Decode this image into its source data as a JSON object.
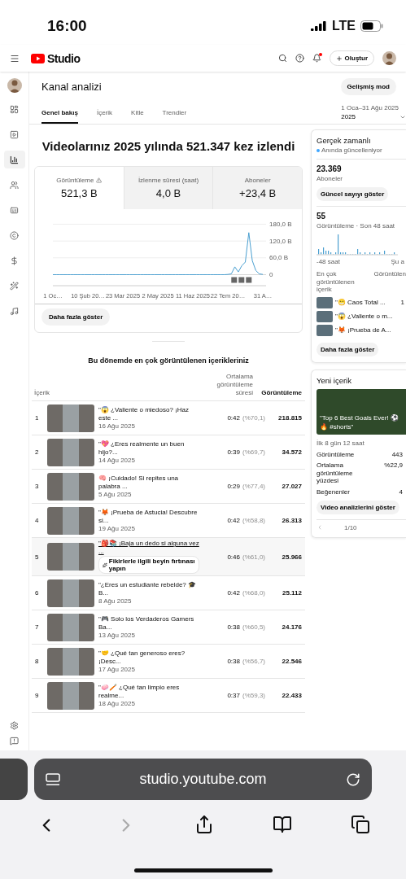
{
  "status_bar": {
    "time": "16:00",
    "network": "LTE"
  },
  "header": {
    "logo_text": "Studio",
    "create_label": "Oluştur",
    "notification_badge": true
  },
  "page": {
    "title": "Kanal analizi",
    "mode_button": "Gelişmiş mod"
  },
  "tabs": [
    {
      "label": "Genel bakış",
      "selected": true
    },
    {
      "label": "İçerik",
      "selected": false
    },
    {
      "label": "Kitle",
      "selected": false
    },
    {
      "label": "Trendler",
      "selected": false
    }
  ],
  "date_range": {
    "range": "1 Oca–31 Ağu 2025",
    "label": "2025"
  },
  "headline": "Videolarınız 2025 yılında 521.347 kez izlendi",
  "metrics": [
    {
      "label": "Görüntüleme",
      "value": "521,3 B",
      "selected": true,
      "warning": true
    },
    {
      "label": "İzlenme süresi (saat)",
      "value": "4,0 B",
      "selected": false,
      "warning": false
    },
    {
      "label": "Aboneler",
      "value": "+23,4 B",
      "selected": false,
      "warning": false
    }
  ],
  "chart_data": {
    "type": "line",
    "categories": [
      "1 Oc…",
      null,
      null,
      null,
      null,
      null,
      null,
      null,
      null,
      null,
      "10 Şub 20…",
      null,
      null,
      null,
      null,
      null,
      null,
      null,
      null,
      null,
      "23 Mar 2025",
      null,
      null,
      null,
      null,
      null,
      null,
      null,
      null,
      null,
      "2 May 2025",
      null,
      null,
      null,
      null,
      null,
      null,
      null,
      null,
      null,
      "11 Haz 2025",
      null,
      null,
      null,
      null,
      null,
      null,
      null,
      null,
      null,
      "22 Tem 20…",
      null,
      null,
      null,
      null,
      null,
      null,
      null,
      null,
      null,
      "31 A…"
    ],
    "series": [
      {
        "color": "#4a9fd0",
        "values": [
          0,
          0,
          0,
          0,
          0,
          0,
          0,
          0,
          0,
          0,
          0,
          0,
          0,
          0,
          0,
          0,
          0,
          0,
          0,
          0,
          0,
          0,
          0,
          0,
          0,
          0,
          0,
          0,
          0,
          0,
          0,
          0,
          0,
          0,
          0,
          0,
          0,
          0,
          0,
          0,
          0,
          0,
          0,
          0,
          0,
          0,
          0,
          0,
          0,
          0,
          1,
          3,
          28,
          10,
          32,
          45,
          150,
          50,
          15,
          3,
          1
        ]
      }
    ],
    "ylim": [
      0,
      180
    ],
    "yticks": [
      {
        "value": 0,
        "label": "0"
      },
      {
        "value": 60,
        "label": "60,0 B"
      },
      {
        "value": 120,
        "label": "120,0 B"
      },
      {
        "value": 180,
        "label": "180,0 B"
      }
    ]
  },
  "show_more": "Daha fazla göster",
  "top_content": {
    "title": "Bu dönemde en çok görüntülenen içerikleriniz",
    "columns": [
      "İçerik",
      "Ortalama görüntüleme süresi",
      "Görüntüleme"
    ],
    "rows": [
      {
        "rank": "1",
        "title": "\"😱 ¿Valiente o miedoso? ¡Haz este ...",
        "date": "16 Ağu 2025",
        "duration": "0:42",
        "percent": "(%70,1)",
        "views": "218.815",
        "hovered": false
      },
      {
        "rank": "2",
        "title": "\"💖 ¿Eres realmente un buen hijo?...",
        "date": "14 Ağu 2025",
        "duration": "0:39",
        "percent": "(%69,7)",
        "views": "34.572",
        "hovered": false
      },
      {
        "rank": "3",
        "title": "🧠 ¡Cuidado! Si repites una palabra ...",
        "date": "5 Ağu 2025",
        "duration": "0:29",
        "percent": "(%77,4)",
        "views": "27.027",
        "hovered": false
      },
      {
        "rank": "4",
        "title": "\"🦊 ¡Prueba de Astucia! Descubre si...",
        "date": "19 Ağu 2025",
        "duration": "0:42",
        "percent": "(%58,8)",
        "views": "26.313",
        "hovered": false
      },
      {
        "rank": "5",
        "title": "\"🎒📚 ¡Baja un dedo si alguna vez ...",
        "suggestion": "Fikirlerle ilgili beyin fırtınası yapın",
        "duration": "0:46",
        "percent": "(%61,0)",
        "views": "25.966",
        "hovered": true
      },
      {
        "rank": "6",
        "title": "\"¿Eres un estudiante rebelde? 🎓 B...",
        "date": "8 Ağu 2025",
        "duration": "0:42",
        "percent": "(%68,0)",
        "views": "25.112",
        "hovered": false
      },
      {
        "rank": "7",
        "title": "\"🎮 Solo los Verdaderos Gamers Ba...",
        "date": "13 Ağu 2025",
        "duration": "0:38",
        "percent": "(%60,5)",
        "views": "24.176",
        "hovered": false
      },
      {
        "rank": "8",
        "title": "\"🤝 ¿Qué tan generoso eres? ¡Desc...",
        "date": "17 Ağu 2025",
        "duration": "0:38",
        "percent": "(%56,7)",
        "views": "22.546",
        "hovered": false
      },
      {
        "rank": "9",
        "title": "\"🧼🪥 ¿Qué tan limpio eres realme...",
        "date": "18 Ağu 2025",
        "duration": "0:37",
        "percent": "(%59,3)",
        "views": "22.433",
        "hovered": false
      }
    ]
  },
  "realtime": {
    "title": "Gerçek zamanlı",
    "subtitle": "Anında güncelleniyor",
    "subscribers": "23.369",
    "subscribers_label": "Aboneler",
    "count_button": "Güncel sayıyı göster",
    "views": "55",
    "views_label": "Görüntüleme · Son 48 saat",
    "axis_start": "-48 saat",
    "axis_end": "Şu a",
    "columns": [
      "En çok görüntülenen içerik",
      "Görüntülen"
    ],
    "items": [
      {
        "title": "\"😁 Caos Total ...",
        "views": "1"
      },
      {
        "title": "\"😱 ¿Valiente o m..."
      },
      {
        "title": "\"🦊 ¡Prueba de A..."
      }
    ],
    "more_button": "Daha fazla göster"
  },
  "new_content": {
    "title": "Yeni içerik",
    "video_title": "\"Top 6 Best Goals Ever! ⚽🔥 #shorts\"",
    "age": "İlk 8 gün 12 saat",
    "stats": [
      {
        "label": "Görüntüleme",
        "value": "443"
      },
      {
        "label": "Ortalama görüntüleme yüzdesi",
        "value": "%22,9"
      },
      {
        "label": "Beğenenler",
        "value": "4"
      }
    ],
    "button": "Video analizlerini göster",
    "page": "1/10"
  },
  "browser": {
    "url": "studio.youtube.com"
  }
}
